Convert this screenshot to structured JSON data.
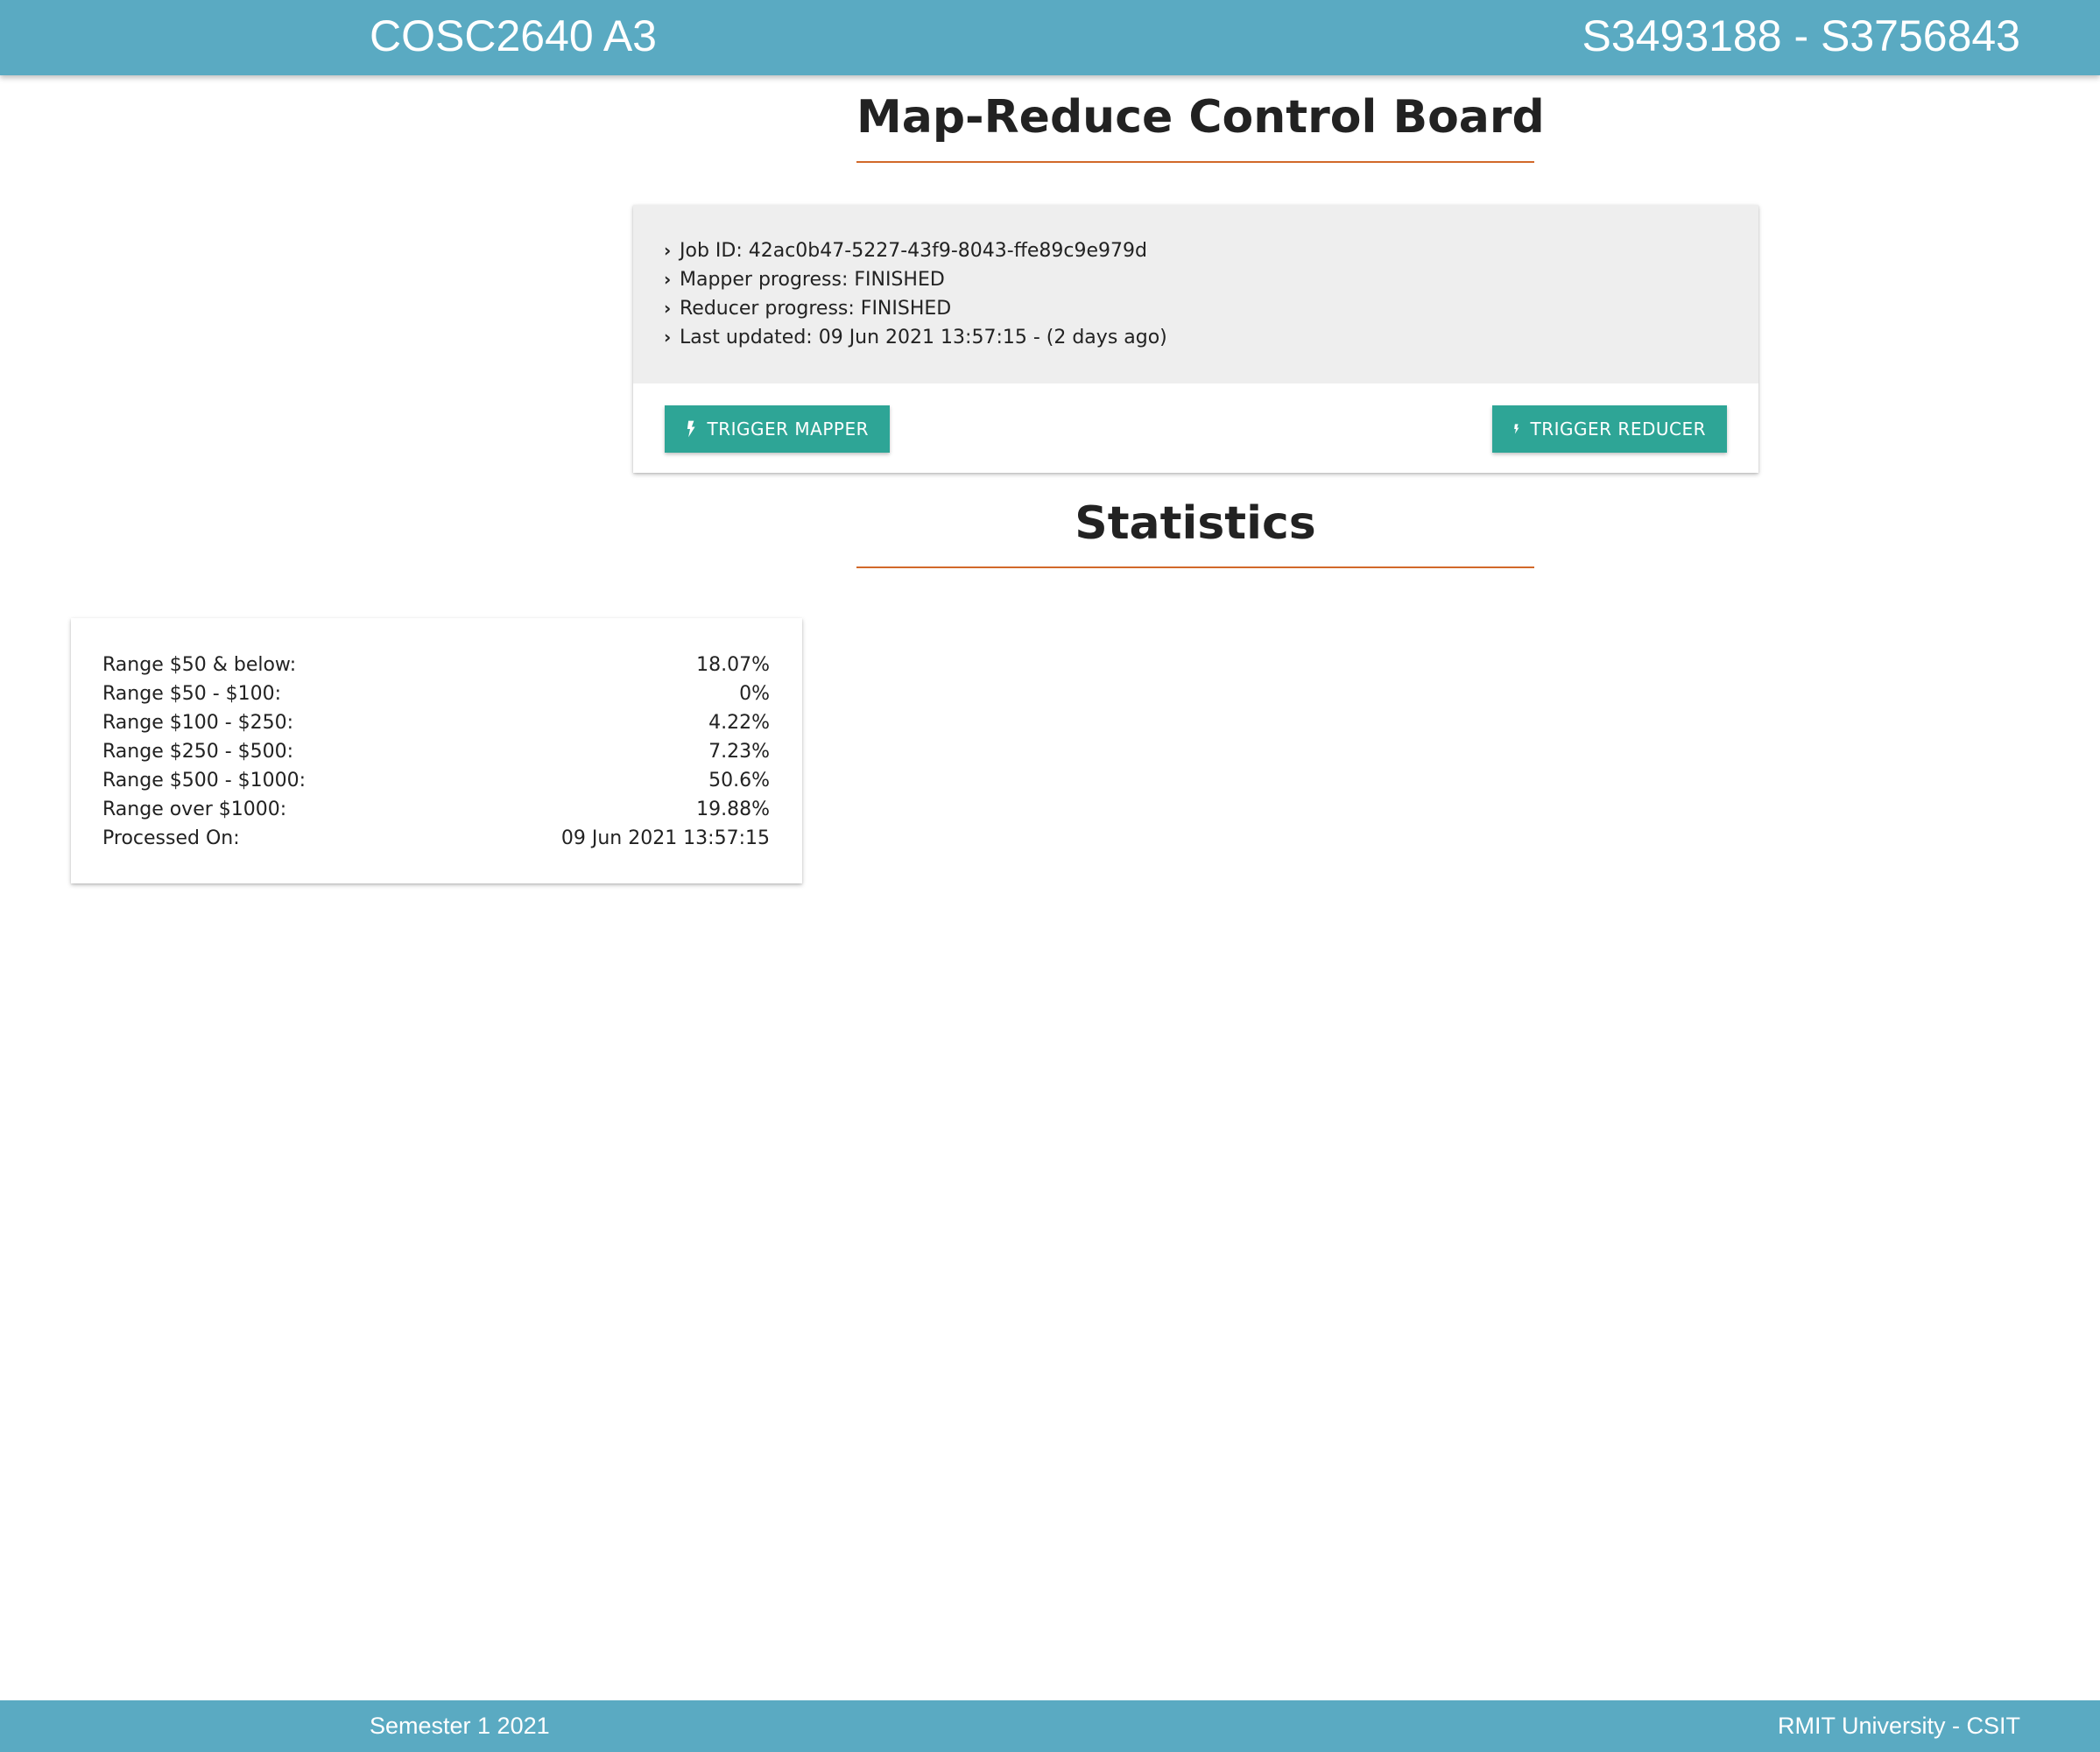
{
  "header": {
    "brand": "COSC2640 A3",
    "student_ids": "S3493188 - S3756843"
  },
  "control_board": {
    "title": "Map-Reduce Control Board",
    "info": [
      {
        "label": "Job ID: 42ac0b47-5227-43f9-8043-ffe89c9e979d"
      },
      {
        "label": "Mapper progress: FINISHED"
      },
      {
        "label": "Reducer progress: FINISHED"
      },
      {
        "label": "Last updated: 09 Jun 2021 13:57:15 - (2 days ago)"
      }
    ],
    "trigger_mapper_label": "TRIGGER MAPPER",
    "trigger_reducer_label": "TRIGGER REDUCER",
    "icons": {
      "info_bullet": "chevron-right-icon",
      "button": "lightning-bolt-icon"
    }
  },
  "statistics": {
    "title": "Statistics",
    "rows": [
      {
        "label": "Range $50 & below:",
        "value": "18.07%"
      },
      {
        "label": "Range $50 - $100:",
        "value": "0%"
      },
      {
        "label": "Range $100 - $250:",
        "value": "4.22%"
      },
      {
        "label": "Range $250 - $500:",
        "value": "7.23%"
      },
      {
        "label": "Range $500 - $1000:",
        "value": "50.6%"
      },
      {
        "label": "Range over $1000:",
        "value": "19.88%"
      },
      {
        "label": "Processed On:",
        "value": "09 Jun 2021 13:57:15"
      }
    ]
  },
  "footer": {
    "left": "Semester 1 2021",
    "right": "RMIT University - CSIT"
  },
  "colors": {
    "nav_bar": "#5aaac2",
    "accent_rule": "#d2692a",
    "button": "#2ea596",
    "info_panel": "#eeeeee"
  }
}
